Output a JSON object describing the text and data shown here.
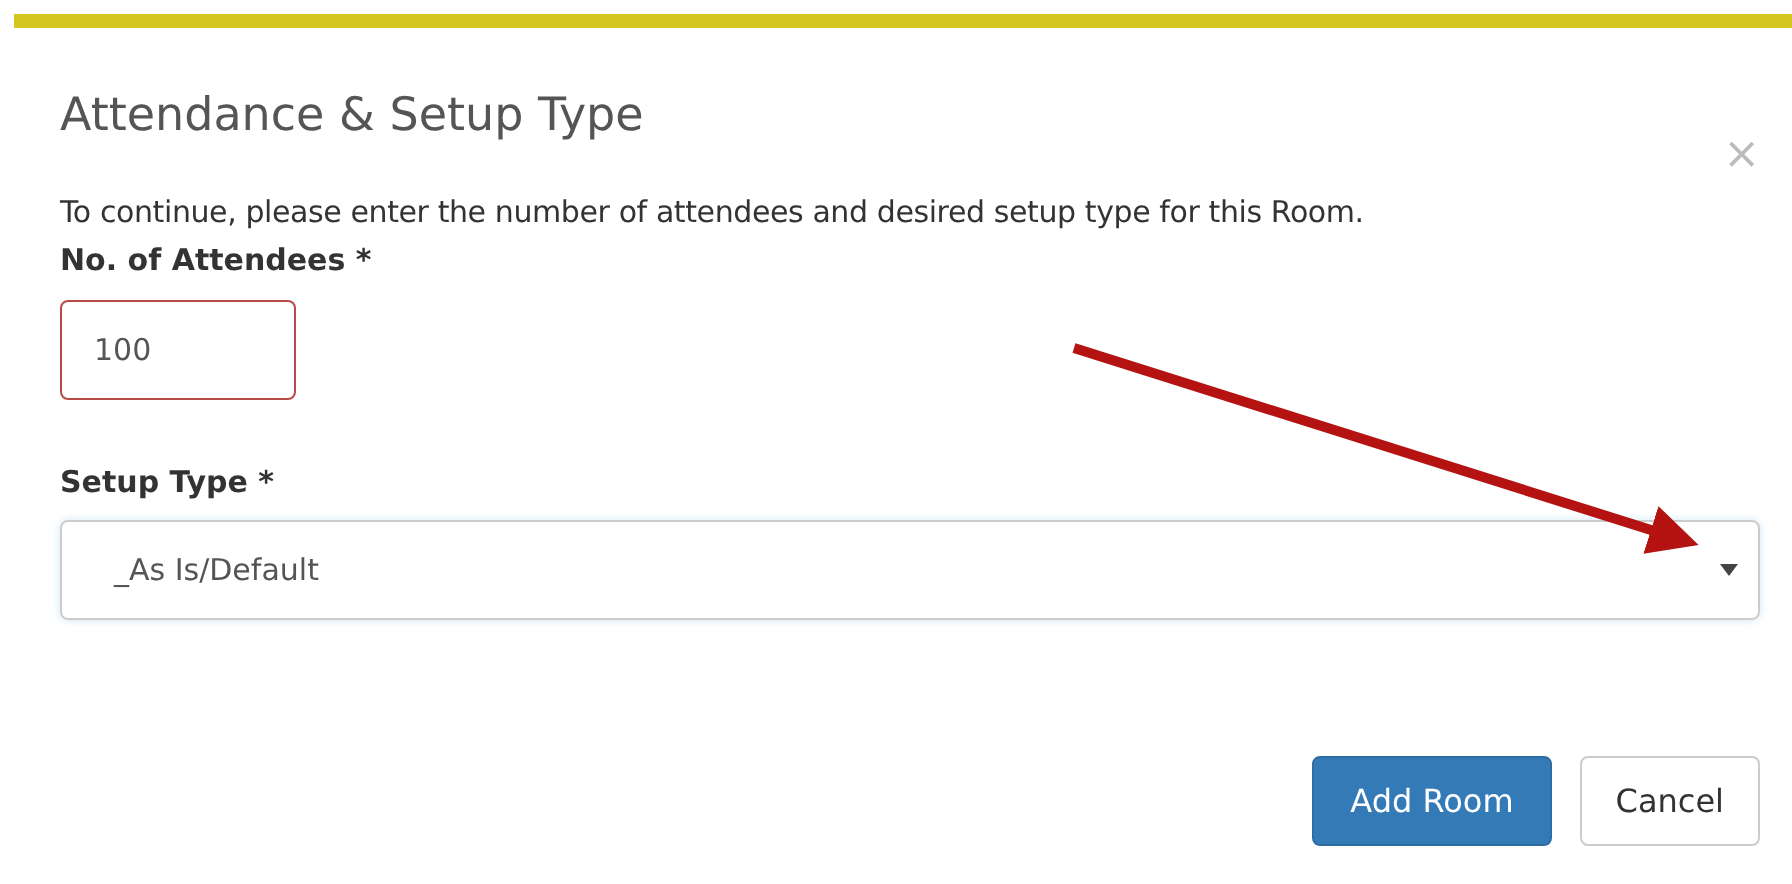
{
  "dialog": {
    "title": "Attendance & Setup Type",
    "close": "×",
    "instructions": "To continue, please enter the number of attendees and desired setup type for this Room.",
    "fields": [
      {
        "kind": "text",
        "label": "No. of Attendees *",
        "value": "100",
        "invalid": true
      },
      {
        "kind": "select",
        "label": "Setup Type *",
        "value": "_As Is/Default",
        "invalid": false
      }
    ],
    "buttons": [
      {
        "label": "Add Room",
        "kind": "primary"
      },
      {
        "label": "Cancel",
        "kind": "secondary"
      }
    ]
  }
}
